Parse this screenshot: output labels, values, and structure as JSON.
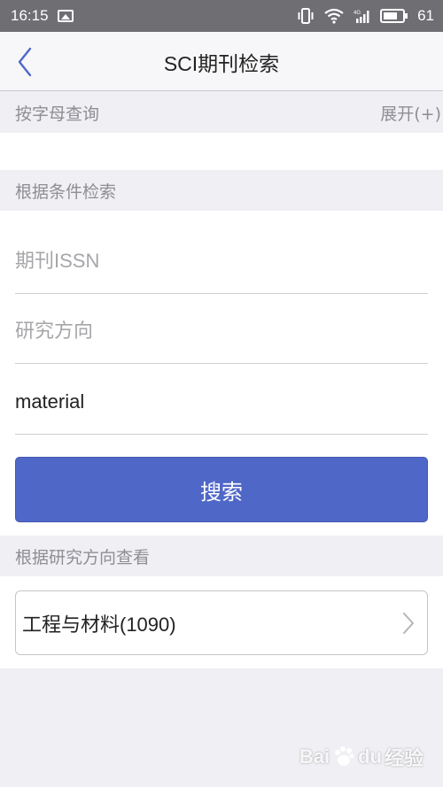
{
  "status_bar": {
    "time": "16:15",
    "battery_level": "61",
    "icons": [
      "image-icon",
      "vibrate-icon",
      "wifi-icon",
      "signal-4g-icon",
      "battery-icon"
    ]
  },
  "nav": {
    "title": "SCI期刊检索",
    "back_icon": "chevron-left-icon"
  },
  "sections": {
    "by_letter": {
      "label": "按字母查询",
      "expand_label": "展开(+)"
    },
    "by_condition": {
      "label": "根据条件检索"
    },
    "by_direction": {
      "label": "根据研究方向查看"
    }
  },
  "form": {
    "issn": {
      "placeholder": "期刊ISSN",
      "value": ""
    },
    "research_direction": {
      "placeholder": "研究方向",
      "value": ""
    },
    "keyword": {
      "placeholder": "",
      "value": "material"
    },
    "search_button": "搜索"
  },
  "categories": [
    {
      "label": "工程与材料(1090)",
      "icon": "chevron-right-icon"
    }
  ],
  "colors": {
    "primary_button": "#4f67c7",
    "status_bar": "#6f6e73",
    "background": "#f0eff4"
  },
  "watermark": {
    "brand": "Bai",
    "brand_suffix": "du",
    "tagline": "经验"
  }
}
